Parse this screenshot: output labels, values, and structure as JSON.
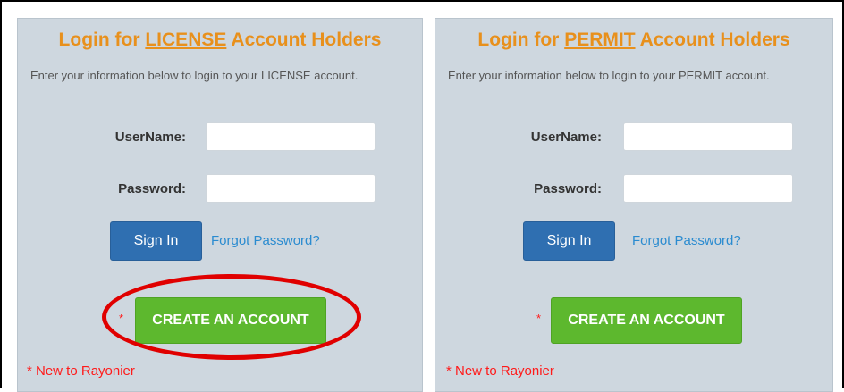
{
  "license_panel": {
    "title_prefix": "Login for ",
    "title_keyword": "LICENSE",
    "title_suffix": " Account Holders",
    "description": "Enter your information below to login to your LICENSE account.",
    "username_label": "UserName:",
    "username_value": "",
    "password_label": "Password:",
    "password_value": "",
    "signin_label": "Sign In",
    "forgot_label": "Forgot Password?",
    "asterisk": "*",
    "create_label": "CREATE AN ACCOUNT",
    "new_to_label": "*  New to Rayonier"
  },
  "permit_panel": {
    "title_prefix": "Login for ",
    "title_keyword": "PERMIT",
    "title_suffix": " Account Holders",
    "description": "Enter your information below to login to your PERMIT account.",
    "username_label": "UserName:",
    "username_value": "",
    "password_label": "Password:",
    "password_value": "",
    "signin_label": "Sign In",
    "forgot_label": "Forgot Password?",
    "asterisk": "*",
    "create_label": "CREATE AN ACCOUNT",
    "new_to_label": "*  New to Rayonier"
  },
  "colors": {
    "title_orange": "#e8901c",
    "panel_bg": "#ced7df",
    "signin_blue": "#2f6fb1",
    "link_blue": "#2a8bd0",
    "create_green": "#5db82e",
    "required_red": "#ff1a1a",
    "annotation_red": "#e00000"
  }
}
